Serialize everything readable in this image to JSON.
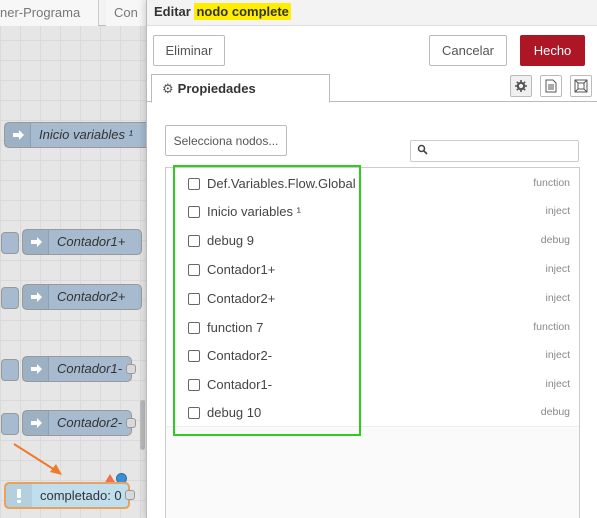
{
  "workspace": {
    "tabs": [
      "ner-Programa",
      "Con"
    ],
    "nodes": [
      {
        "label": "Inicio variables ¹"
      },
      {
        "label": "Contador1+"
      },
      {
        "label": "Contador2+"
      },
      {
        "label": "Contador1-"
      },
      {
        "label": "Contador2-"
      }
    ],
    "complete_node": {
      "label": "completado: 0"
    }
  },
  "tray": {
    "title_prefix": "Editar",
    "title_highlight": "nodo complete",
    "buttons": {
      "delete": "Eliminar",
      "cancel": "Cancelar",
      "done": "Hecho"
    },
    "tab_properties": "Propiedades",
    "select_nodes": "Selecciona nodos...",
    "search_placeholder": ""
  },
  "node_list": [
    {
      "name": "Def.Variables.Flow.Global",
      "type": "function"
    },
    {
      "name": "Inicio variables ¹",
      "type": "inject"
    },
    {
      "name": "debug 9",
      "type": "debug"
    },
    {
      "name": "Contador1+",
      "type": "inject"
    },
    {
      "name": "Contador2+",
      "type": "inject"
    },
    {
      "name": "function 7",
      "type": "function"
    },
    {
      "name": "Contador2-",
      "type": "inject"
    },
    {
      "name": "Contador1-",
      "type": "inject"
    },
    {
      "name": "debug 10",
      "type": "debug"
    }
  ],
  "colors": {
    "done_button": "#ad1625",
    "title_highlight": "#ffee00",
    "selection_outline": "#2ecc1f",
    "annotation_arrow": "#f07a28",
    "inject_node": "#a6bbcf",
    "complete_node": "#c0deed"
  },
  "icons": [
    "arrow-right-icon",
    "gear-icon",
    "file-icon",
    "layout-icon",
    "search-icon",
    "alert-icon"
  ]
}
